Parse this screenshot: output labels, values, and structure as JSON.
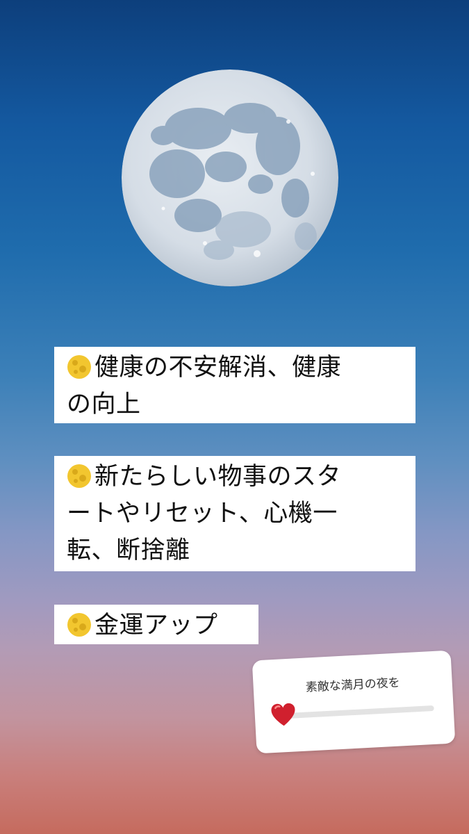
{
  "items": [
    {
      "icon": "full-moon-icon",
      "lines": [
        "健康の不安解消、健康",
        "の向上"
      ]
    },
    {
      "icon": "full-moon-icon",
      "lines": [
        "新たらしい物事のスタ",
        "ートやリセット、心機一",
        "転、断捨離"
      ]
    },
    {
      "icon": "full-moon-icon",
      "lines": [
        "金運アップ"
      ]
    }
  ],
  "slider_sticker": {
    "question": "素敵な満月の夜を",
    "emoji": "heart-icon",
    "value": 0
  },
  "colors": {
    "sky_top": "#0d3f7c",
    "sky_bottom": "#c56b5e",
    "heart": "#d0202e"
  }
}
